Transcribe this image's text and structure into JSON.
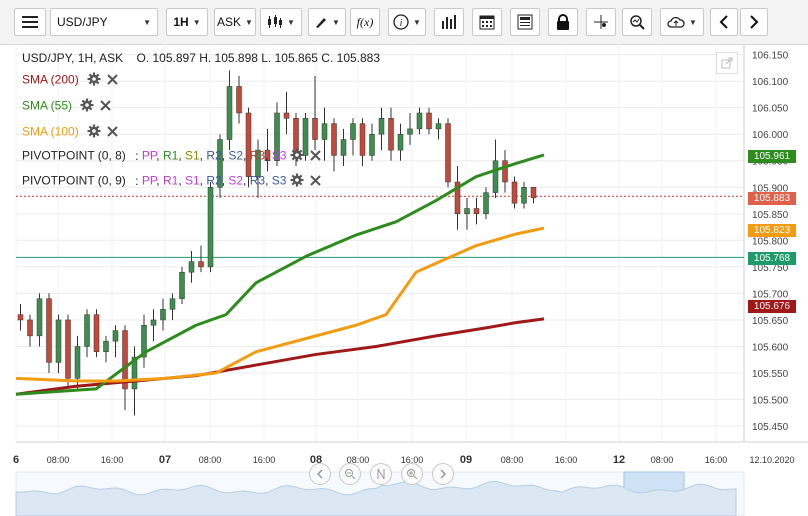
{
  "toolbar": {
    "symbol": "USD/JPY",
    "timeframe": "1H",
    "price_type": "ASK",
    "buttons": [
      "menu-icon",
      "candles-icon",
      "draw-icon",
      "function-icon",
      "info-icon",
      "volume-bars-icon",
      "calendar-icon",
      "news-icon",
      "lock-icon",
      "crosshair-icon",
      "zoom-icon",
      "cloud-upload-icon",
      "arrow-left-icon",
      "arrow-right-icon"
    ]
  },
  "header": {
    "pair_info": "USD/JPY, 1H, ASK",
    "ohlc": "O. 105.897 H. 105.898 L. 105.865 C. 105.883"
  },
  "indicators": [
    {
      "label": "SMA (200)",
      "color": "#a01818"
    },
    {
      "label": "SMA (55)",
      "color": "#2e8b1d"
    },
    {
      "label": "SMA (100)",
      "color": "#f39c12"
    }
  ],
  "pivots": [
    {
      "label": "PIVOTPOINT (0, 8)",
      "items": [
        {
          "text": "PP",
          "color": "#c23bd4"
        },
        {
          "text": "R1",
          "color": "#2e8b1d"
        },
        {
          "text": "S1",
          "color": "#888800"
        },
        {
          "text": "R2",
          "color": "#3c5a9a"
        },
        {
          "text": "S2",
          "color": "#3c5a9a"
        },
        {
          "text": "R3",
          "color": "#c0392b"
        },
        {
          "text": "S3",
          "color": "#c23bd4"
        }
      ]
    },
    {
      "label": "PIVOTPOINT (0, 9)",
      "items": [
        {
          "text": "PP",
          "color": "#c23bd4"
        },
        {
          "text": "R1",
          "color": "#c23bd4"
        },
        {
          "text": "S1",
          "color": "#c23bd4"
        },
        {
          "text": "R2",
          "color": "#3c5a9a"
        },
        {
          "text": "S2",
          "color": "#c23bd4"
        },
        {
          "text": "R3",
          "color": "#3c5a9a"
        },
        {
          "text": "S3",
          "color": "#3c5a9a"
        }
      ]
    }
  ],
  "price_labels": [
    {
      "value": "105.961",
      "color": "#2e8b1d"
    },
    {
      "value": "105.883",
      "color": "#e0604a"
    },
    {
      "value": "105.823",
      "color": "#f39c12"
    },
    {
      "value": "105.768",
      "color": "#1f9a6a"
    },
    {
      "value": "105.676",
      "color": "#a01818"
    }
  ],
  "chart_data": {
    "type": "line",
    "title": "USD/JPY, 1H, ASK",
    "y_ticks": [
      "106.150",
      "106.100",
      "106.050",
      "106.000",
      "105.950",
      "105.900",
      "105.850",
      "105.800",
      "105.750",
      "105.700",
      "105.650",
      "105.600",
      "105.550",
      "105.500",
      "105.450"
    ],
    "ylim": [
      105.42,
      106.17
    ],
    "x_ticks": [
      "6",
      "08:00",
      "16:00",
      "07",
      "08:00",
      "16:00",
      "08",
      "08:00",
      "16:00",
      "09",
      "08:00",
      "16:00",
      "12",
      "08:00",
      "16:00",
      "12.10.2020"
    ],
    "horizontal_line": 105.768,
    "series": [
      {
        "name": "SMA (200)",
        "color": "#a01818",
        "points": [
          [
            0,
            105.51
          ],
          [
            60,
            105.525
          ],
          [
            120,
            105.535
          ],
          [
            180,
            105.545
          ],
          [
            240,
            105.565
          ],
          [
            300,
            105.585
          ],
          [
            360,
            105.6
          ],
          [
            420,
            105.62
          ],
          [
            470,
            105.635
          ],
          [
            500,
            105.645
          ],
          [
            528,
            105.652
          ]
        ]
      },
      {
        "name": "SMA (55)",
        "color": "#2e8b1d",
        "points": [
          [
            0,
            105.51
          ],
          [
            80,
            105.52
          ],
          [
            130,
            105.59
          ],
          [
            180,
            105.64
          ],
          [
            210,
            105.66
          ],
          [
            240,
            105.72
          ],
          [
            290,
            105.77
          ],
          [
            340,
            105.81
          ],
          [
            380,
            105.835
          ],
          [
            420,
            105.875
          ],
          [
            460,
            105.92
          ],
          [
            500,
            105.945
          ],
          [
            528,
            105.961
          ]
        ]
      },
      {
        "name": "SMA (100)",
        "color": "#f39c12",
        "points": [
          [
            0,
            105.54
          ],
          [
            60,
            105.535
          ],
          [
            100,
            105.535
          ],
          [
            150,
            105.54
          ],
          [
            200,
            105.55
          ],
          [
            240,
            105.59
          ],
          [
            300,
            105.62
          ],
          [
            340,
            105.64
          ],
          [
            370,
            105.66
          ],
          [
            400,
            105.74
          ],
          [
            430,
            105.765
          ],
          [
            460,
            105.79
          ],
          [
            500,
            105.812
          ],
          [
            528,
            105.823
          ]
        ]
      }
    ],
    "candles": [
      {
        "t": 1,
        "o": 105.66,
        "h": 105.68,
        "l": 105.63,
        "c": 105.65
      },
      {
        "t": 2,
        "o": 105.65,
        "h": 105.66,
        "l": 105.6,
        "c": 105.62
      },
      {
        "t": 3,
        "o": 105.62,
        "h": 105.7,
        "l": 105.6,
        "c": 105.69
      },
      {
        "t": 4,
        "o": 105.69,
        "h": 105.7,
        "l": 105.55,
        "c": 105.57
      },
      {
        "t": 5,
        "o": 105.57,
        "h": 105.66,
        "l": 105.55,
        "c": 105.65
      },
      {
        "t": 6,
        "o": 105.65,
        "h": 105.66,
        "l": 105.52,
        "c": 105.54
      },
      {
        "t": 7,
        "o": 105.54,
        "h": 105.62,
        "l": 105.52,
        "c": 105.6
      },
      {
        "t": 8,
        "o": 105.6,
        "h": 105.67,
        "l": 105.58,
        "c": 105.66
      },
      {
        "t": 9,
        "o": 105.66,
        "h": 105.67,
        "l": 105.58,
        "c": 105.59
      },
      {
        "t": 10,
        "o": 105.59,
        "h": 105.62,
        "l": 105.57,
        "c": 105.61
      },
      {
        "t": 11,
        "o": 105.61,
        "h": 105.64,
        "l": 105.58,
        "c": 105.63
      },
      {
        "t": 12,
        "o": 105.63,
        "h": 105.64,
        "l": 105.48,
        "c": 105.52
      },
      {
        "t": 13,
        "o": 105.52,
        "h": 105.6,
        "l": 105.47,
        "c": 105.58
      },
      {
        "t": 14,
        "o": 105.58,
        "h": 105.66,
        "l": 105.56,
        "c": 105.64
      },
      {
        "t": 15,
        "o": 105.64,
        "h": 105.67,
        "l": 105.61,
        "c": 105.65
      },
      {
        "t": 16,
        "o": 105.65,
        "h": 105.69,
        "l": 105.63,
        "c": 105.67
      },
      {
        "t": 17,
        "o": 105.67,
        "h": 105.7,
        "l": 105.65,
        "c": 105.69
      },
      {
        "t": 18,
        "o": 105.69,
        "h": 105.75,
        "l": 105.68,
        "c": 105.74
      },
      {
        "t": 19,
        "o": 105.74,
        "h": 105.78,
        "l": 105.72,
        "c": 105.76
      },
      {
        "t": 20,
        "o": 105.76,
        "h": 105.79,
        "l": 105.74,
        "c": 105.75
      },
      {
        "t": 21,
        "o": 105.75,
        "h": 105.91,
        "l": 105.74,
        "c": 105.9
      },
      {
        "t": 22,
        "o": 105.9,
        "h": 106.0,
        "l": 105.88,
        "c": 105.99
      },
      {
        "t": 23,
        "o": 105.99,
        "h": 106.12,
        "l": 105.97,
        "c": 106.09
      },
      {
        "t": 24,
        "o": 106.09,
        "h": 106.11,
        "l": 106.02,
        "c": 106.04
      },
      {
        "t": 25,
        "o": 106.04,
        "h": 106.05,
        "l": 105.9,
        "c": 105.92
      },
      {
        "t": 26,
        "o": 105.92,
        "h": 105.99,
        "l": 105.88,
        "c": 105.97
      },
      {
        "t": 27,
        "o": 105.97,
        "h": 106.01,
        "l": 105.93,
        "c": 105.95
      },
      {
        "t": 28,
        "o": 105.95,
        "h": 106.06,
        "l": 105.94,
        "c": 106.04
      },
      {
        "t": 29,
        "o": 106.04,
        "h": 106.08,
        "l": 106.0,
        "c": 106.03
      },
      {
        "t": 30,
        "o": 106.03,
        "h": 106.04,
        "l": 105.94,
        "c": 105.96
      },
      {
        "t": 31,
        "o": 105.96,
        "h": 106.04,
        "l": 105.95,
        "c": 106.03
      },
      {
        "t": 32,
        "o": 106.03,
        "h": 106.11,
        "l": 105.97,
        "c": 105.99
      },
      {
        "t": 33,
        "o": 105.99,
        "h": 106.05,
        "l": 105.95,
        "c": 106.02
      },
      {
        "t": 34,
        "o": 106.02,
        "h": 106.03,
        "l": 105.93,
        "c": 105.96
      },
      {
        "t": 35,
        "o": 105.96,
        "h": 106.01,
        "l": 105.94,
        "c": 105.99
      },
      {
        "t": 36,
        "o": 105.99,
        "h": 106.03,
        "l": 105.96,
        "c": 106.02
      },
      {
        "t": 37,
        "o": 106.02,
        "h": 106.03,
        "l": 105.94,
        "c": 105.96
      },
      {
        "t": 38,
        "o": 105.96,
        "h": 106.02,
        "l": 105.95,
        "c": 106.0
      },
      {
        "t": 39,
        "o": 106.0,
        "h": 106.05,
        "l": 105.97,
        "c": 106.03
      },
      {
        "t": 40,
        "o": 106.03,
        "h": 106.05,
        "l": 105.95,
        "c": 105.97
      },
      {
        "t": 41,
        "o": 105.97,
        "h": 106.02,
        "l": 105.95,
        "c": 106.0
      },
      {
        "t": 42,
        "o": 106.0,
        "h": 106.04,
        "l": 105.98,
        "c": 106.01
      },
      {
        "t": 43,
        "o": 106.01,
        "h": 106.05,
        "l": 106.0,
        "c": 106.04
      },
      {
        "t": 44,
        "o": 106.04,
        "h": 106.05,
        "l": 106.0,
        "c": 106.01
      },
      {
        "t": 45,
        "o": 106.01,
        "h": 106.03,
        "l": 105.99,
        "c": 106.02
      },
      {
        "t": 46,
        "o": 106.02,
        "h": 106.03,
        "l": 105.9,
        "c": 105.91
      },
      {
        "t": 47,
        "o": 105.91,
        "h": 105.94,
        "l": 105.82,
        "c": 105.85
      },
      {
        "t": 48,
        "o": 105.85,
        "h": 105.88,
        "l": 105.82,
        "c": 105.86
      },
      {
        "t": 49,
        "o": 105.86,
        "h": 105.88,
        "l": 105.83,
        "c": 105.85
      },
      {
        "t": 50,
        "o": 105.85,
        "h": 105.9,
        "l": 105.84,
        "c": 105.89
      },
      {
        "t": 51,
        "o": 105.89,
        "h": 105.99,
        "l": 105.88,
        "c": 105.95
      },
      {
        "t": 52,
        "o": 105.95,
        "h": 105.97,
        "l": 105.89,
        "c": 105.91
      },
      {
        "t": 53,
        "o": 105.91,
        "h": 105.92,
        "l": 105.86,
        "c": 105.87
      },
      {
        "t": 54,
        "o": 105.87,
        "h": 105.91,
        "l": 105.86,
        "c": 105.9
      },
      {
        "t": 55,
        "o": 105.9,
        "h": 105.9,
        "l": 105.87,
        "c": 105.88
      }
    ]
  }
}
